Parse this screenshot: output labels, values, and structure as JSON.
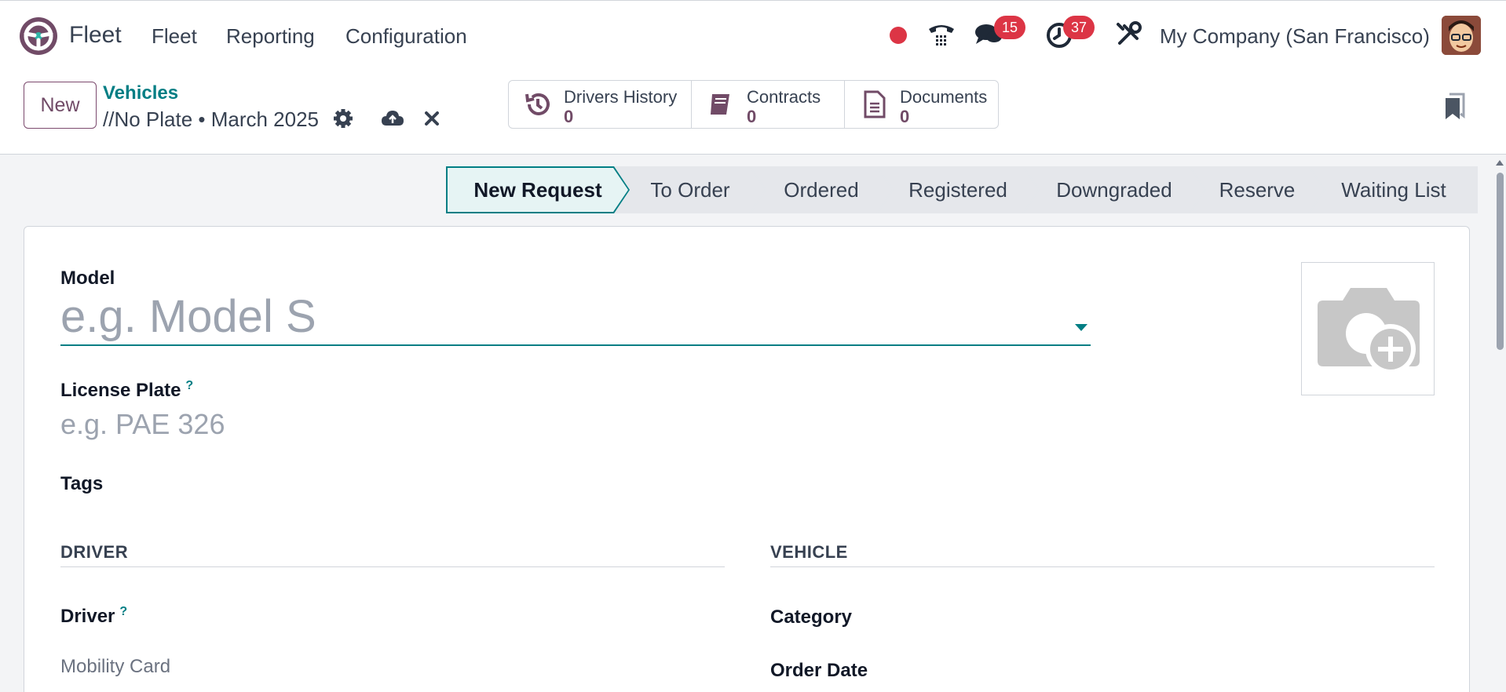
{
  "navbar": {
    "app_name": "Fleet",
    "menus": [
      "Fleet",
      "Reporting",
      "Configuration"
    ],
    "messages_count": "15",
    "activities_count": "37",
    "company": "My Company (San Francisco)",
    "icons": [
      "fleet-logo-icon",
      "record-icon",
      "phone-icon",
      "chat-icon",
      "clock-icon",
      "tools-icon",
      "avatar"
    ],
    "colors": {
      "brand": "#714b67",
      "accent": "#017e84",
      "badge": "#dc3545"
    }
  },
  "control": {
    "new_label": "New",
    "breadcrumb": "Vehicles",
    "record_name": "//No Plate • March 2025",
    "smart_buttons": [
      {
        "label": "Drivers History",
        "count": "0",
        "icon": "history-icon"
      },
      {
        "label": "Contracts",
        "count": "0",
        "icon": "book-icon"
      },
      {
        "label": "Documents",
        "count": "0",
        "icon": "document-icon"
      }
    ]
  },
  "statusbar": {
    "stages": [
      "New Request",
      "To Order",
      "Ordered",
      "Registered",
      "Downgraded",
      "Reserve",
      "Waiting List"
    ],
    "active": "New Request"
  },
  "form": {
    "model_label": "Model",
    "model_placeholder": "e.g. Model S",
    "plate_label": "License Plate",
    "plate_help": "?",
    "plate_placeholder": "e.g. PAE 326",
    "tags_label": "Tags",
    "driver_section": "DRIVER",
    "vehicle_section": "VEHICLE",
    "driver_label": "Driver",
    "driver_help": "?",
    "mobility_card_label": "Mobility Card",
    "category_label": "Category",
    "order_date_label": "Order Date"
  }
}
